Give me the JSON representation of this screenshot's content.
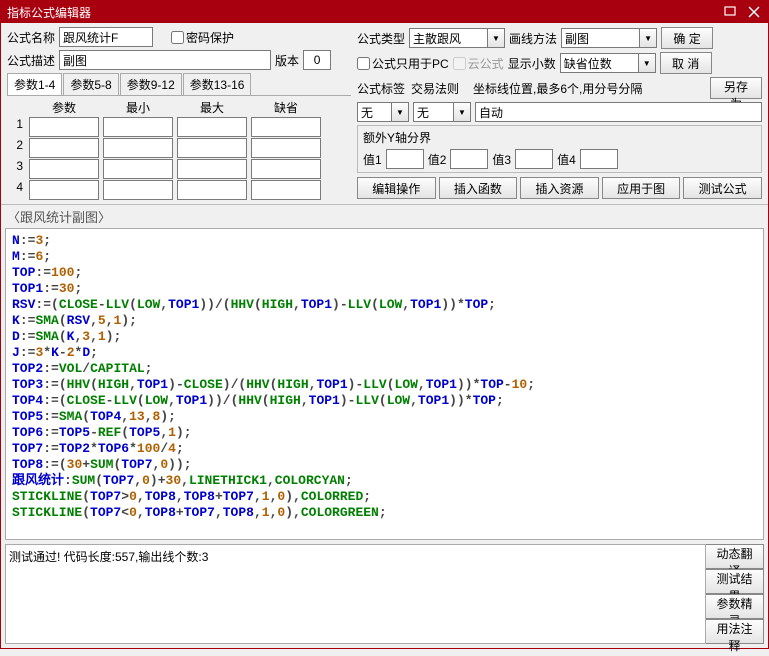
{
  "title": "指标公式编辑器",
  "labels": {
    "name": "公式名称",
    "pwd": "密码保护",
    "desc": "公式描述",
    "version": "版本",
    "ftype": "公式类型",
    "drawmethod": "画线方法",
    "pconly": "公式只用于PC",
    "cloud": "云公式",
    "decimals": "显示小数",
    "ftag": "公式标签",
    "traderule": "交易法则",
    "coordhint": "坐标线位置,最多6个,用分号分隔",
    "extra_y": "额外Y轴分界",
    "val1": "值1",
    "val2": "值2",
    "val3": "值3",
    "val4": "值4"
  },
  "buttons": {
    "ok": "确 定",
    "cancel": "取 消",
    "saveas": "另存为",
    "editop": "编辑操作",
    "insfn": "插入函数",
    "insres": "插入资源",
    "apply": "应用于图",
    "test": "测试公式",
    "dyntrans": "动态翻译",
    "testres": "测试结果",
    "paramwiz": "参数精灵",
    "usage": "用法注释"
  },
  "values": {
    "name": "跟风统计F",
    "desc": "副图",
    "version": "0",
    "ftype": "主散跟风",
    "drawmethod": "副图",
    "decimals": "缺省位数",
    "ftag": "无",
    "traderule": "无",
    "coord": "自动"
  },
  "tabs": [
    "参数1-4",
    "参数5-8",
    "参数9-12",
    "参数13-16"
  ],
  "param_headers": [
    "参数",
    "最小",
    "最大",
    "缺省"
  ],
  "editor_heading": "〈跟风统计副图〉",
  "status": "测试通过! 代码长度:557,输出线个数:3",
  "chart_data": {
    "type": "table",
    "note": "formula source code lines for indicator editor",
    "lines": [
      "N:=3;",
      "M:=6;",
      "TOP:=100;",
      "TOP1:=30;",
      "RSV:=(CLOSE-LLV(LOW,TOP1))/(HHV(HIGH,TOP1)-LLV(LOW,TOP1))*TOP;",
      "K:=SMA(RSV,5,1);",
      "D:=SMA(K,3,1);",
      "J:=3*K-2*D;",
      "TOP2:=VOL/CAPITAL;",
      "TOP3:=(HHV(HIGH,TOP1)-CLOSE)/(HHV(HIGH,TOP1)-LLV(LOW,TOP1))*TOP-10;",
      "TOP4:=(CLOSE-LLV(LOW,TOP1))/(HHV(HIGH,TOP1)-LLV(LOW,TOP1))*TOP;",
      "TOP5:=SMA(TOP4,13,8);",
      "TOP6:=TOP5-REF(TOP5,1);",
      "TOP7:=TOP2*TOP6*100/4;",
      "TOP8:=(30+SUM(TOP7,0));",
      "跟风统计:SUM(TOP7,0)+30,LINETHICK1,COLORCYAN;",
      "STICKLINE(TOP7>0,TOP8,TOP8+TOP7,1,0),COLORRED;",
      "STICKLINE(TOP7<0,TOP8+TOP7,TOP8,1,0),COLORGREEN;"
    ]
  }
}
